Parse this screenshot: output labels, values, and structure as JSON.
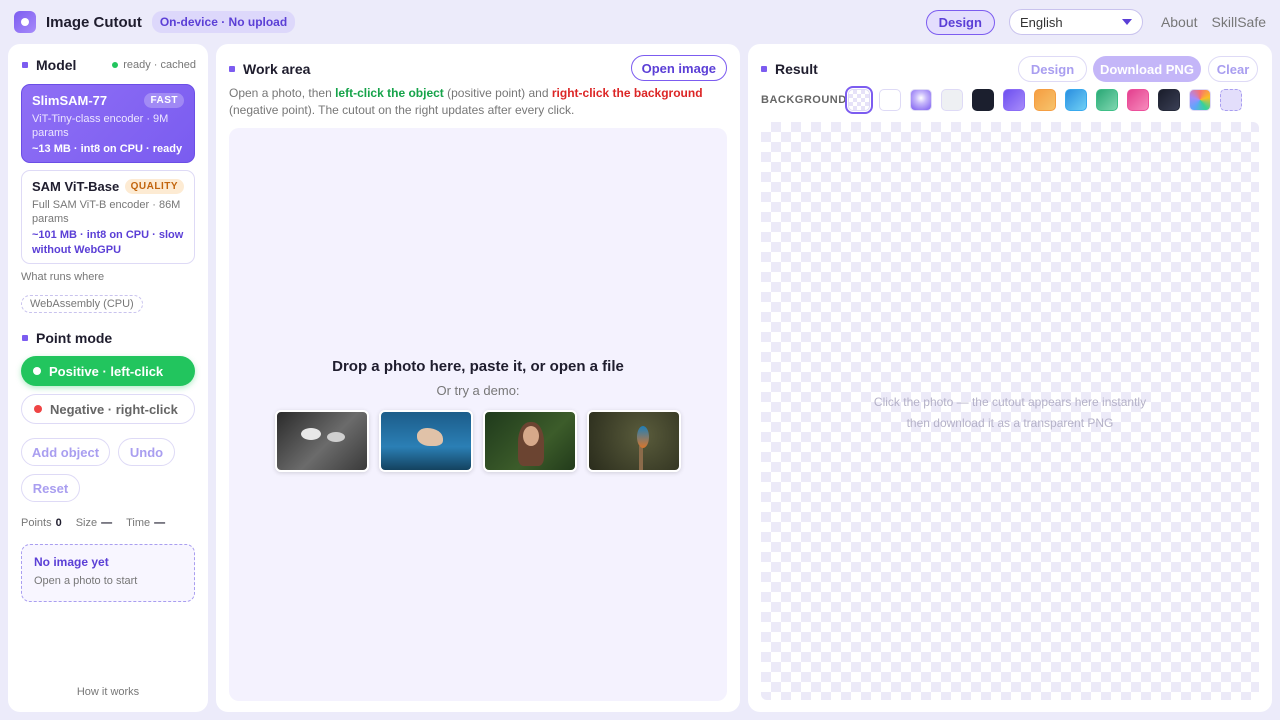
{
  "app": {
    "title": "Image Cutout",
    "badge": "On-device · No upload",
    "design_button": "Design",
    "language": "English",
    "links": [
      "About",
      "SkillSafe"
    ]
  },
  "left": {
    "model_title": "Model",
    "status": "ready · cached",
    "models": [
      {
        "name": "SlimSAM-77",
        "tag": "FAST",
        "desc": "ViT-Tiny-class encoder · 9M params",
        "meta": "~13 MB · int8 on CPU · ready",
        "selected": true
      },
      {
        "name": "SAM ViT-Base",
        "tag": "QUALITY",
        "desc": "Full SAM ViT-B encoder · 86M params",
        "meta": "~101 MB · int8 on CPU · slow without WebGPU",
        "selected": false
      }
    ],
    "what_runs_where": "What runs where",
    "runtime_chip": "WebAssembly (CPU)",
    "point_mode_title": "Point mode",
    "positive_label": "Positive · left-click",
    "negative_label": "Negative · right-click",
    "add_object": "Add object",
    "undo": "Undo",
    "reset": "Reset",
    "stats": {
      "points_label": "Points",
      "points_value": "0",
      "size_label": "Size",
      "size_value": "—",
      "time_label": "Time",
      "time_value": "—"
    },
    "no_image_title": "No image yet",
    "no_image_sub": "Open a photo to start",
    "how_it_works": "How it works"
  },
  "work": {
    "title": "Work area",
    "open_button": "Open image",
    "instr_1": "Open a photo, then ",
    "instr_pos": "left-click the object",
    "instr_2": " (positive point) and ",
    "instr_neg": "right-click the background",
    "instr_3": " (negative point). The cutout on the right updates after every click.",
    "drop_title": "Drop a photo here, paste it, or open a file",
    "drop_sub": "Or try a demo:",
    "demos": [
      "coffee",
      "dancer",
      "portrait",
      "kingfisher"
    ]
  },
  "result": {
    "title": "Result",
    "design_button": "Design",
    "download_button": "Download PNG",
    "clear_button": "Clear",
    "background_label": "BACKGROUND",
    "swatches": [
      {
        "name": "transparent",
        "value": "checker"
      },
      {
        "name": "white",
        "value": "#ffffff"
      },
      {
        "name": "glow",
        "value": "radial-violet"
      },
      {
        "name": "light-gray",
        "value": "#eef0f3"
      },
      {
        "name": "dark-navy",
        "value": "#1b1f2e"
      },
      {
        "name": "violet",
        "value": "#8b6cf6"
      },
      {
        "name": "orange",
        "value": "#f59e42"
      },
      {
        "name": "sky",
        "value": "#38a9ee"
      },
      {
        "name": "green",
        "value": "#3fbf87"
      },
      {
        "name": "pink",
        "value": "#ec4f9b"
      },
      {
        "name": "charcoal",
        "value": "#262a3a"
      },
      {
        "name": "rainbow",
        "value": "multicolor"
      },
      {
        "name": "custom",
        "value": "#e3defb"
      }
    ],
    "placeholder_1": "Click the photo — the cutout appears here instantly",
    "placeholder_2": "then download it as a transparent PNG"
  },
  "colors": {
    "accent": "#7c5cf0",
    "positive": "#22c55e",
    "negative": "#ef4444"
  }
}
